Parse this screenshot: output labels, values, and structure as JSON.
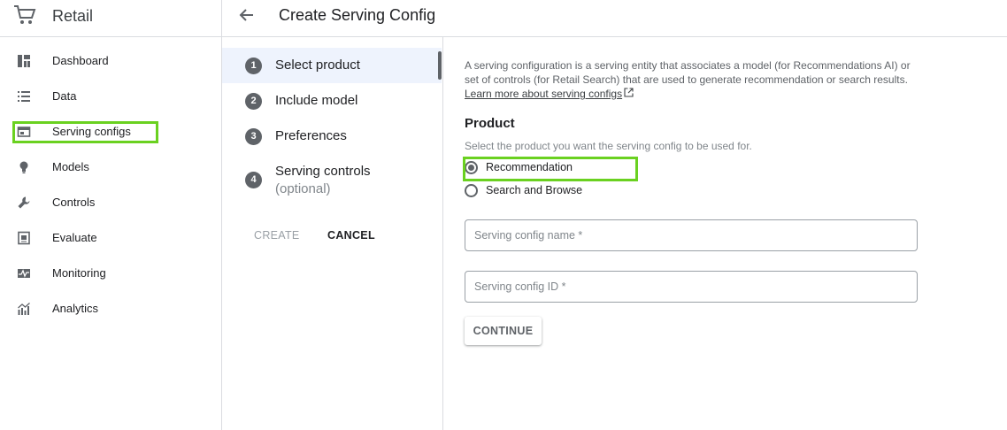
{
  "app": {
    "title": "Retail",
    "cart_icon": "shopping-cart-icon"
  },
  "sidebar": {
    "items": [
      {
        "label": "Dashboard",
        "icon": "dashboard-icon"
      },
      {
        "label": "Data",
        "icon": "list-icon"
      },
      {
        "label": "Serving configs",
        "icon": "serving-configs-icon",
        "highlighted": true
      },
      {
        "label": "Models",
        "icon": "lightbulb-icon"
      },
      {
        "label": "Controls",
        "icon": "wrench-icon"
      },
      {
        "label": "Evaluate",
        "icon": "evaluate-icon"
      },
      {
        "label": "Monitoring",
        "icon": "monitoring-icon"
      },
      {
        "label": "Analytics",
        "icon": "analytics-icon"
      }
    ]
  },
  "header": {
    "back_icon": "back-arrow-icon",
    "title": "Create Serving Config"
  },
  "stepper": {
    "steps": [
      {
        "number": "1",
        "label": "Select product",
        "active": true
      },
      {
        "number": "2",
        "label": "Include model"
      },
      {
        "number": "3",
        "label": "Preferences"
      },
      {
        "number": "4",
        "label": "Serving controls",
        "sublabel": "(optional)"
      }
    ],
    "create_label": "CREATE",
    "cancel_label": "CANCEL"
  },
  "main": {
    "description": "A serving configuration is a serving entity that associates a model (for Recommendations AI) or set of controls (for Retail Search) that are used to generate recommendation or search results.",
    "learn_more": "Learn more about serving configs",
    "section_title": "Product",
    "section_hint": "Select the product you want the serving config to be used for.",
    "options": [
      {
        "label": "Recommendation",
        "checked": true
      },
      {
        "label": "Search and Browse",
        "checked": false
      }
    ],
    "name_placeholder": "Serving config name *",
    "id_placeholder": "Serving config ID *",
    "continue_label": "CONTINUE"
  },
  "colors": {
    "highlight": "#6ad120",
    "accent_bg": "#eef3fd",
    "icon": "#5f6368"
  }
}
